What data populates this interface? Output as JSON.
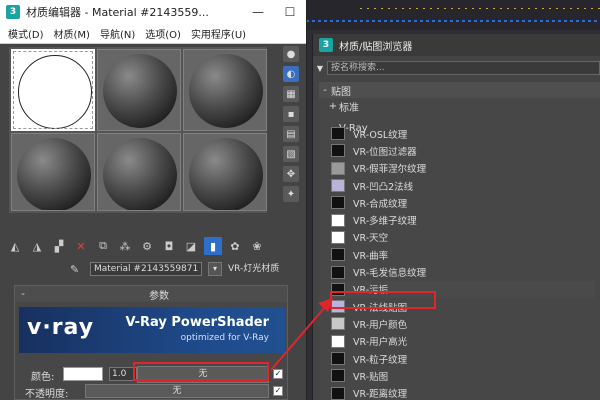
{
  "material_editor": {
    "title": "材质编辑器 - Material #2143559...",
    "window_controls": {
      "minimize": "—",
      "maximize": "☐"
    },
    "menu": [
      "模式(D)",
      "材质(M)",
      "导航(N)",
      "选项(O)",
      "实用程序(U)"
    ],
    "material_name": "Material #2143559871",
    "material_type": "VR-灯光材质",
    "params_title": "参数",
    "params_collapse": "-",
    "vray_logo": "v·ray",
    "vray_banner_title": "V-Ray PowerShader",
    "vray_banner_sub": "optimized for V-Ray",
    "color_label": "颜色:",
    "color_value": "1.0",
    "color_map": "无",
    "opacity_label": "不透明度:",
    "opacity_map": "无",
    "check_mark": "✓"
  },
  "map_browser": {
    "title": "材质/贴图浏览器",
    "search_placeholder": "按名称搜索...",
    "group_maps": "贴图",
    "group_maps_sign": "-",
    "group_standard": "标准",
    "group_standard_sign": "+",
    "group_vray": "V-Ray",
    "group_vray_sign": "-",
    "items": [
      "VR-OSL纹理",
      "VR-位图过滤器",
      "VR-假菲涅尔纹理",
      "VR-凹凸2法线",
      "VR-合成纹理",
      "VR-多维子纹理",
      "VR-天空",
      "VR-曲率",
      "VR-毛发信息纹理",
      "VR-污垢",
      "VR-法线贴图",
      "VR-用户颜色",
      "VR-用户高光",
      "VR-粒子纹理",
      "VR-贴图",
      "VR-距离纹理"
    ],
    "item_colors": [
      "#111111",
      "#111111",
      "#9a9a9a",
      "#b8b4d8",
      "#111111",
      "#ffffff",
      "#ffffff",
      "#111111",
      "#111111",
      "#111111",
      "#b8b4e0",
      "#c8c8c8",
      "#ffffff",
      "#111111",
      "#111111",
      "#111111"
    ],
    "selected_item": "VR-污垢"
  },
  "colors": {
    "annotation_red": "#e0262d",
    "vray_blue": "#1f4b8c",
    "app_logo": "#1aa3a3"
  }
}
